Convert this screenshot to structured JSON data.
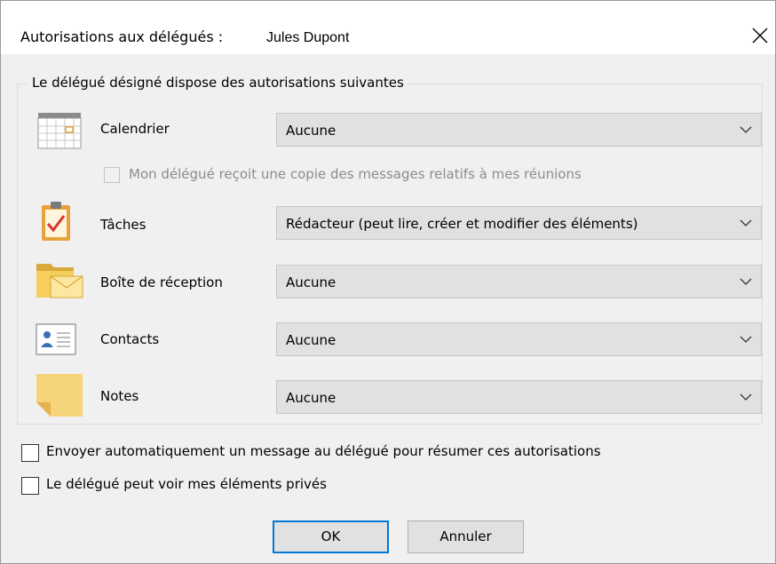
{
  "dialog": {
    "title_prefix": "Autorisations aux délégués : ",
    "delegate_name": "Jules Dupont"
  },
  "group": {
    "label": "Le délégué désigné dispose des autorisations suivantes"
  },
  "permissions": [
    {
      "label": "Calendrier",
      "value": "Aucune",
      "icon": "calendar-icon"
    },
    {
      "label": "Tâches",
      "value": "Rédacteur (peut lire, créer et modifier des éléments)",
      "icon": "tasks-icon"
    },
    {
      "label": "Boîte de réception",
      "value": "Aucune",
      "icon": "inbox-icon"
    },
    {
      "label": "Contacts",
      "value": "Aucune",
      "icon": "contacts-icon"
    },
    {
      "label": "Notes",
      "value": "Aucune",
      "icon": "notes-icon"
    }
  ],
  "meeting_copy": {
    "label": "Mon délégué reçoit une copie des messages relatifs à mes réunions",
    "checked": false,
    "disabled": true
  },
  "options": {
    "auto_send": {
      "label": "Envoyer automatiquement un message au délégué pour résumer ces autorisations",
      "checked": false
    },
    "private_items": {
      "label": "Le délégué peut voir mes éléments privés",
      "checked": false
    }
  },
  "buttons": {
    "ok": "OK",
    "cancel": "Annuler"
  }
}
